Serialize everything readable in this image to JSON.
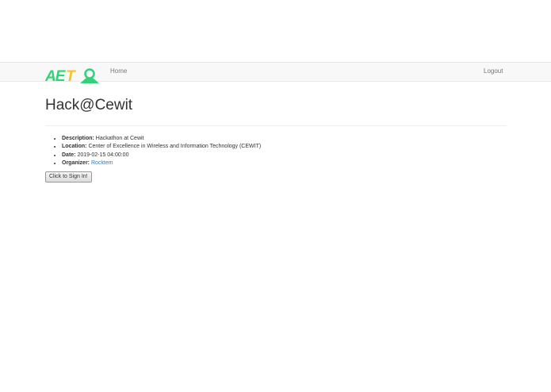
{
  "navbar": {
    "logo_text": "AETO",
    "home_label": "Home",
    "logout_label": "Logout",
    "colors": {
      "logo_green": "#32d27a",
      "logo_yellow": "#f7c325"
    }
  },
  "event": {
    "title": "Hack@Cewit",
    "details": [
      {
        "label": "Description:",
        "value": "Hackathon at Cewit"
      },
      {
        "label": "Location:",
        "value": "Center of Excellence in Wireless and Information Technology (CEWIT)"
      },
      {
        "label": "Date:",
        "value": "2019-02-15 04:00:00"
      },
      {
        "label": "Organizer:",
        "value": "Rocktem"
      }
    ],
    "signin_label": "Click to Sign In!"
  }
}
